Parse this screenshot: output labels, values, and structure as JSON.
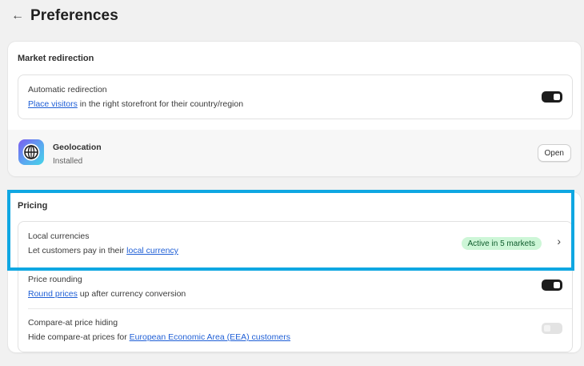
{
  "header": {
    "back_icon": "←",
    "title": "Preferences"
  },
  "market_redirection": {
    "title": "Market redirection",
    "automatic_redirection": {
      "label": "Automatic redirection",
      "desc_link": "Place visitors",
      "desc_rest": " in the right storefront for their country/region",
      "toggle_on": true
    },
    "geolocation": {
      "name": "Geolocation",
      "status": "Installed",
      "button": "Open",
      "icon": "globe-icon"
    }
  },
  "pricing": {
    "title": "Pricing",
    "local_currencies": {
      "label": "Local currencies",
      "desc_prefix": "Let customers pay in their ",
      "desc_link": "local currency",
      "badge": "Active in 5 markets",
      "chevron": "›"
    },
    "price_rounding": {
      "label": "Price rounding",
      "desc_link": "Round prices",
      "desc_rest": " up after currency conversion",
      "toggle_on": true
    },
    "compare_at": {
      "label": "Compare-at price hiding",
      "desc_prefix": "Hide compare-at prices for ",
      "desc_link": "European Economic Area (EEA) customers",
      "toggle_on": false
    }
  },
  "colors": {
    "highlight": "#0fa7e2",
    "link": "#1f5fd6",
    "badge_bg": "#cdf6d7",
    "toggle_on": "#1c1c1c"
  }
}
